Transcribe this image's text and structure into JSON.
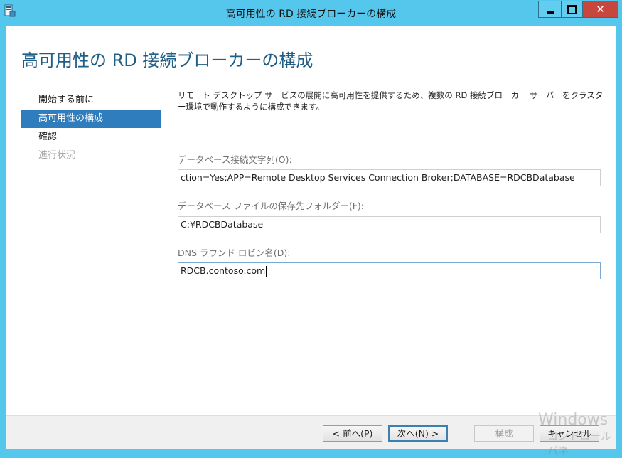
{
  "window": {
    "title": "高可用性の RD 接続ブローカーの構成",
    "icon": "server-manager-icon"
  },
  "page_title": "高可用性の RD 接続ブローカーの構成",
  "nav": {
    "items": [
      {
        "label": "開始する前に",
        "state": "normal"
      },
      {
        "label": "高可用性の構成",
        "state": "active"
      },
      {
        "label": "確認",
        "state": "normal"
      },
      {
        "label": "進行状況",
        "state": "disabled"
      }
    ]
  },
  "content": {
    "description": "リモート デスクトップ サービスの展開に高可用性を提供するため、複数の RD 接続ブローカー サーバーをクラスター環境で動作するように構成できます。",
    "db_conn_label": "データベース接続文字列(O):",
    "db_conn_value": "ction=Yes;APP=Remote Desktop Services Connection Broker;DATABASE=RDCBDatabase",
    "db_folder_label": "データベース ファイルの保存先フォルダー(F):",
    "db_folder_value": "C:¥RDCBDatabase",
    "dns_label": "DNS ラウンド ロビン名(D):",
    "dns_value": "RDCB.contoso.com"
  },
  "footer": {
    "prev_label": "< 前へ(P)",
    "next_label": "次へ(N) >",
    "create_label": "構成",
    "cancel_label": "キャンセル"
  },
  "watermark": {
    "line1": "Windows",
    "line2": "コントロール パネ"
  },
  "colors": {
    "titlebar": "#55c7ec",
    "active_nav": "#2f7dbd",
    "close_button": "#c7463e",
    "title_text": "#1f5e86"
  }
}
